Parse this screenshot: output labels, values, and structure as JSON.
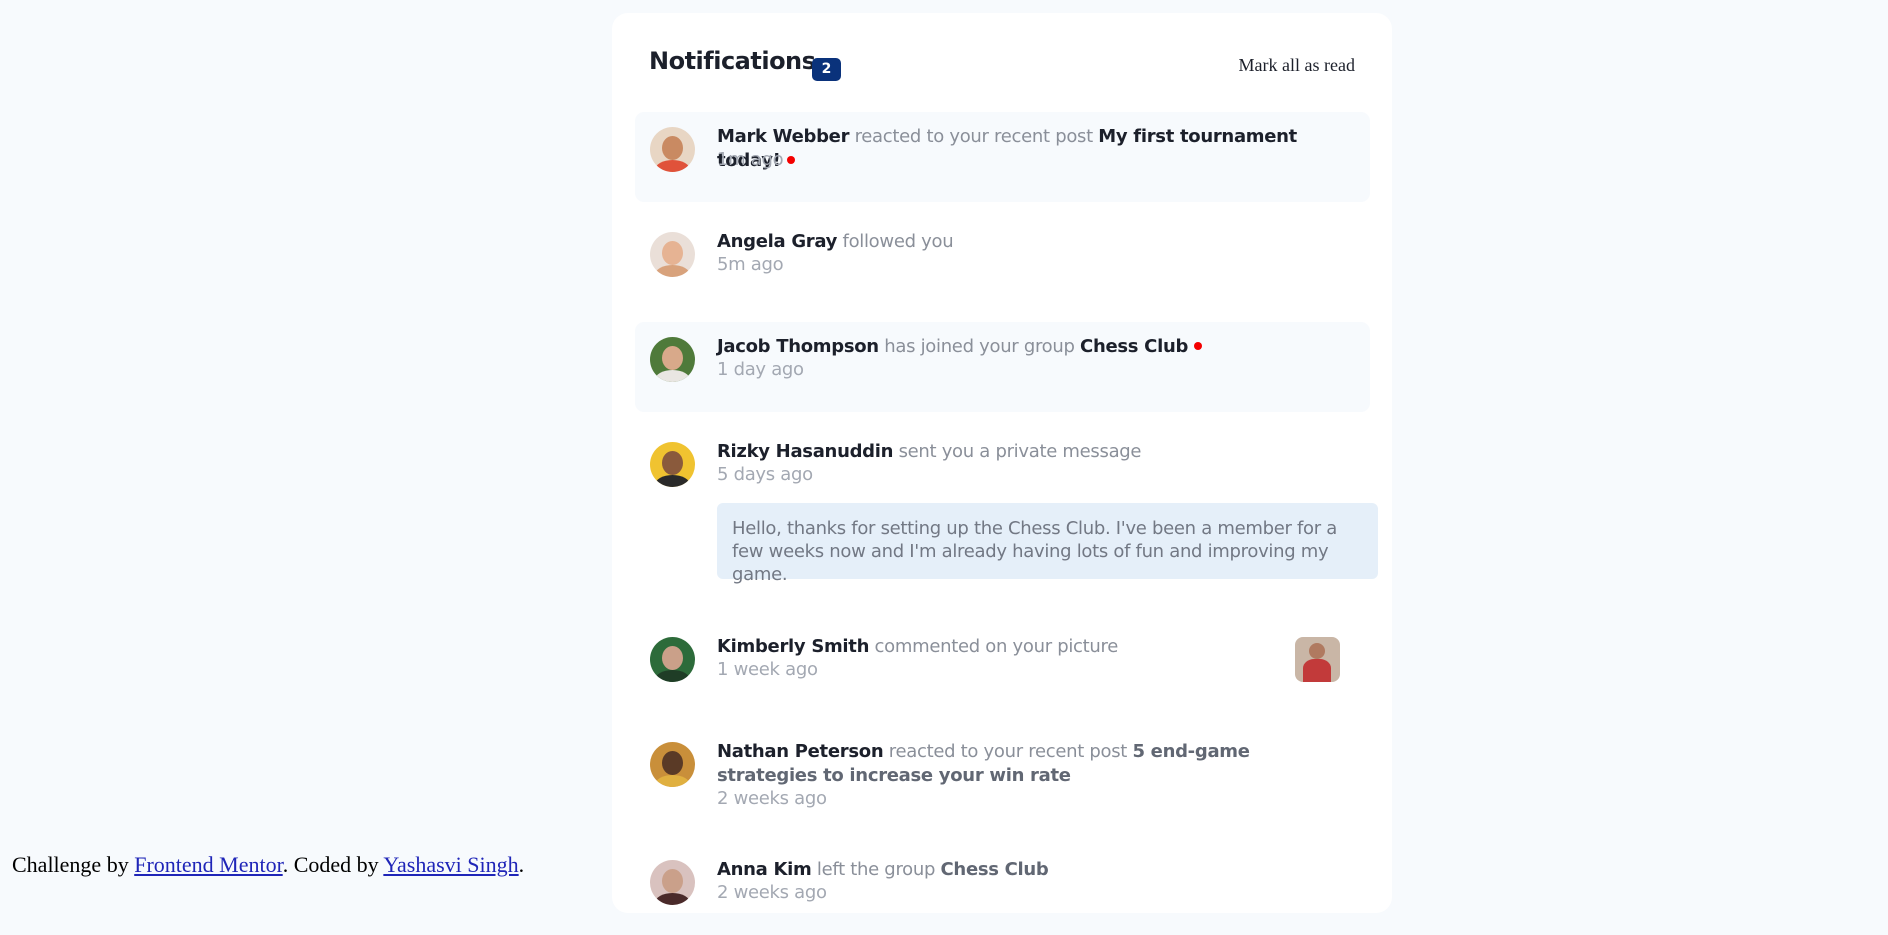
{
  "header": {
    "title": "Notifications",
    "unread_count": "2",
    "mark_all_label": "Mark all as read"
  },
  "notifications": [
    {
      "name": "Mark Webber",
      "action": "reacted to your recent post",
      "object": "My first tournament today!",
      "time": "1m ago",
      "unread": true
    },
    {
      "name": "Angela Gray",
      "action": "followed you",
      "time": "5m ago",
      "unread": false
    },
    {
      "name": "Jacob Thompson",
      "action": "has joined your group",
      "object": "Chess Club",
      "time": "1 day ago",
      "unread": true
    },
    {
      "name": "Rizky Hasanuddin",
      "action": "sent you a private message",
      "time": "5 days ago",
      "message": "Hello, thanks for setting up the Chess Club. I've been a member for a few weeks now and I'm already having lots of fun and improving my game.",
      "unread": false
    },
    {
      "name": "Kimberly Smith",
      "action": "commented on your picture",
      "time": "1 week ago",
      "unread": false
    },
    {
      "name": "Nathan Peterson",
      "action": "reacted to your recent post",
      "object": "5 end-game strategies to increase your win rate",
      "time": "2 weeks ago",
      "unread": false
    },
    {
      "name": "Anna Kim",
      "action": "left the group",
      "object": "Chess Club",
      "time": "2 weeks ago",
      "unread": false
    }
  ],
  "footer": {
    "prefix": "Challenge by",
    "link1": "Frontend Mentor",
    "middle": ". Coded by",
    "link2": "Yashasvi Singh",
    "suffix": "."
  },
  "colors": {
    "badge": "#0a327b",
    "unread_dot": "#f40000",
    "unread_bg": "#f7fafd",
    "message_bg": "#e5eff9"
  }
}
